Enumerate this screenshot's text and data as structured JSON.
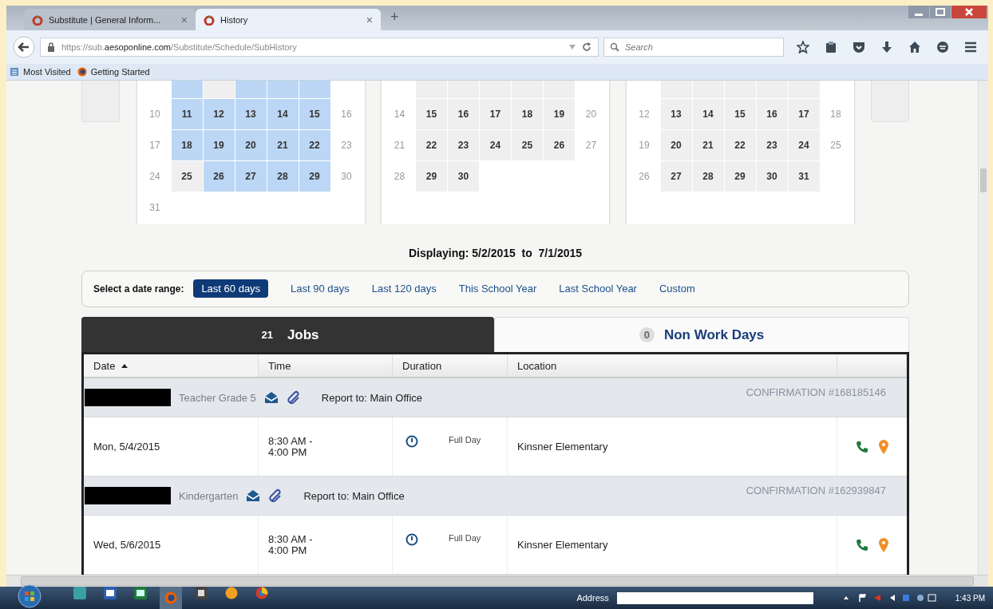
{
  "browser": {
    "tabs": [
      {
        "title": "Substitute | General Inform...",
        "selected": false,
        "close": "×"
      },
      {
        "title": "History",
        "selected": true,
        "close": "×"
      }
    ],
    "new_tab": "+",
    "url": "https://sub.**aesoponline.com**/Substitute/Schedule/SubHistory",
    "search": {
      "placeholder": "Search"
    },
    "bookmarks": [
      "Most Visited",
      "Getting Started"
    ]
  },
  "calendars": [
    {
      "weeks": [
        [
          {
            "kind": "weekend"
          },
          {
            "kind": "weekday",
            "selected": true
          },
          {
            "kind": "weekday",
            "selected": false
          },
          {
            "kind": "weekday",
            "selected": true
          },
          {
            "kind": "weekday",
            "selected": true
          },
          {
            "kind": "weekday",
            "selected": true
          },
          {
            "kind": "weekend"
          }
        ],
        [
          {
            "text": "10",
            "kind": "weekend",
            "selected": false
          },
          {
            "text": "11",
            "kind": "weekday",
            "selected": true
          },
          {
            "text": "12",
            "kind": "weekday",
            "selected": true
          },
          {
            "text": "13",
            "kind": "weekday",
            "selected": true
          },
          {
            "text": "14",
            "kind": "weekday",
            "selected": true
          },
          {
            "text": "15",
            "kind": "weekday",
            "selected": true
          },
          {
            "text": "16",
            "kind": "weekend",
            "selected": false
          }
        ],
        [
          {
            "text": "17",
            "kind": "weekend",
            "selected": false
          },
          {
            "text": "18",
            "kind": "weekday",
            "selected": true
          },
          {
            "text": "19",
            "kind": "weekday",
            "selected": true
          },
          {
            "text": "20",
            "kind": "weekday",
            "selected": true
          },
          {
            "text": "21",
            "kind": "weekday",
            "selected": true
          },
          {
            "text": "22",
            "kind": "weekday",
            "selected": true
          },
          {
            "text": "23",
            "kind": "weekend",
            "selected": false
          }
        ],
        [
          {
            "text": "24",
            "kind": "weekend",
            "selected": false
          },
          {
            "text": "25",
            "kind": "weekday",
            "selected": false
          },
          {
            "text": "26",
            "kind": "weekday",
            "selected": true
          },
          {
            "text": "27",
            "kind": "weekday",
            "selected": true
          },
          {
            "text": "28",
            "kind": "weekday",
            "selected": true
          },
          {
            "text": "29",
            "kind": "weekday",
            "selected": true
          },
          {
            "text": "30",
            "kind": "weekend",
            "selected": false
          }
        ],
        [
          {
            "text": "31",
            "kind": "weekend",
            "selected": false
          }
        ]
      ]
    },
    {
      "weeks": [
        [
          {
            "kind": "weekend"
          },
          {
            "kind": "weekday",
            "selected": false
          },
          {
            "kind": "weekday",
            "selected": false
          },
          {
            "kind": "weekday",
            "selected": false
          },
          {
            "kind": "weekday",
            "selected": false
          },
          {
            "kind": "weekday",
            "selected": false
          },
          {
            "kind": "weekend"
          }
        ],
        [
          {
            "text": "14",
            "kind": "weekend",
            "selected": false
          },
          {
            "text": "15",
            "kind": "weekday",
            "selected": false
          },
          {
            "text": "16",
            "kind": "weekday",
            "selected": false
          },
          {
            "text": "17",
            "kind": "weekday",
            "selected": false
          },
          {
            "text": "18",
            "kind": "weekday",
            "selected": false
          },
          {
            "text": "19",
            "kind": "weekday",
            "selected": false
          },
          {
            "text": "20",
            "kind": "weekend",
            "selected": false
          }
        ],
        [
          {
            "text": "21",
            "kind": "weekend",
            "selected": false
          },
          {
            "text": "22",
            "kind": "weekday",
            "selected": false
          },
          {
            "text": "23",
            "kind": "weekday",
            "selected": false
          },
          {
            "text": "24",
            "kind": "weekday",
            "selected": false
          },
          {
            "text": "25",
            "kind": "weekday",
            "selected": false
          },
          {
            "text": "26",
            "kind": "weekday",
            "selected": false
          },
          {
            "text": "27",
            "kind": "weekend",
            "selected": false
          }
        ],
        [
          {
            "text": "28",
            "kind": "weekend",
            "selected": false
          },
          {
            "text": "29",
            "kind": "weekday",
            "selected": false
          },
          {
            "text": "30",
            "kind": "weekday",
            "selected": false
          }
        ]
      ]
    },
    {
      "weeks": [
        [
          {
            "kind": "weekend"
          },
          {
            "kind": "weekday",
            "selected": false
          },
          {
            "kind": "weekday",
            "selected": false
          },
          {
            "kind": "weekday",
            "selected": false
          },
          {
            "kind": "weekday",
            "selected": false
          },
          {
            "kind": "weekday",
            "selected": false
          },
          {
            "kind": "weekend"
          }
        ],
        [
          {
            "text": "12",
            "kind": "weekend",
            "selected": false
          },
          {
            "text": "13",
            "kind": "weekday",
            "selected": false
          },
          {
            "text": "14",
            "kind": "weekday",
            "selected": false
          },
          {
            "text": "15",
            "kind": "weekday",
            "selected": false
          },
          {
            "text": "16",
            "kind": "weekday",
            "selected": false
          },
          {
            "text": "17",
            "kind": "weekday",
            "selected": false
          },
          {
            "text": "18",
            "kind": "weekend",
            "selected": false
          }
        ],
        [
          {
            "text": "19",
            "kind": "weekend",
            "selected": false
          },
          {
            "text": "20",
            "kind": "weekday",
            "selected": false
          },
          {
            "text": "21",
            "kind": "weekday",
            "selected": false
          },
          {
            "text": "22",
            "kind": "weekday",
            "selected": false
          },
          {
            "text": "23",
            "kind": "weekday",
            "selected": false
          },
          {
            "text": "24",
            "kind": "weekday",
            "selected": false
          },
          {
            "text": "25",
            "kind": "weekend",
            "selected": false
          }
        ],
        [
          {
            "text": "26",
            "kind": "weekend",
            "selected": false
          },
          {
            "text": "27",
            "kind": "weekday",
            "selected": false
          },
          {
            "text": "28",
            "kind": "weekday",
            "selected": false
          },
          {
            "text": "29",
            "kind": "weekday",
            "selected": false
          },
          {
            "text": "30",
            "kind": "weekday",
            "selected": false
          },
          {
            "text": "31",
            "kind": "weekday",
            "selected": false
          }
        ]
      ]
    }
  ],
  "displaying": "Displaying: 5/2/2015  to  7/1/2015",
  "date_range": {
    "label": "Select a date range:",
    "options": [
      {
        "label": "Last 60 days",
        "selected": true
      },
      {
        "label": "Last 90 days",
        "selected": false
      },
      {
        "label": "Last 120 days",
        "selected": false
      },
      {
        "label": "This School Year",
        "selected": false
      },
      {
        "label": "Last School Year",
        "selected": false
      },
      {
        "label": "Custom",
        "selected": false
      }
    ]
  },
  "tabs": [
    {
      "count": "21",
      "label": "Jobs",
      "selected": true
    },
    {
      "count": "0",
      "label": "Non Work Days",
      "selected": false
    }
  ],
  "table": {
    "columns": [
      {
        "label": "Date",
        "sorted": true
      },
      {
        "label": "Time",
        "sorted": false
      },
      {
        "label": "Duration",
        "sorted": false
      },
      {
        "label": "Location",
        "sorted": false
      }
    ],
    "jobs": [
      {
        "redacted": true,
        "position": "Teacher Grade 5",
        "report_to": "Report to: Main Office",
        "confirmation": "CONFIRMATION #168185146",
        "date": "Mon, 5/4/2015",
        "time": "8:30 AM - 4:00 PM",
        "duration": "Full Day",
        "location": "Kinsner Elementary"
      },
      {
        "redacted": true,
        "position": "Kindergarten",
        "report_to": "Report to: Main Office",
        "confirmation": "CONFIRMATION #162939847",
        "date": "Wed, 5/6/2015",
        "time": "8:30 AM - 4:00 PM",
        "duration": "Full Day",
        "location": "Kinsner Elementary"
      }
    ]
  },
  "taskbar": {
    "address_label": "Address",
    "clock": "1:43 PM"
  }
}
